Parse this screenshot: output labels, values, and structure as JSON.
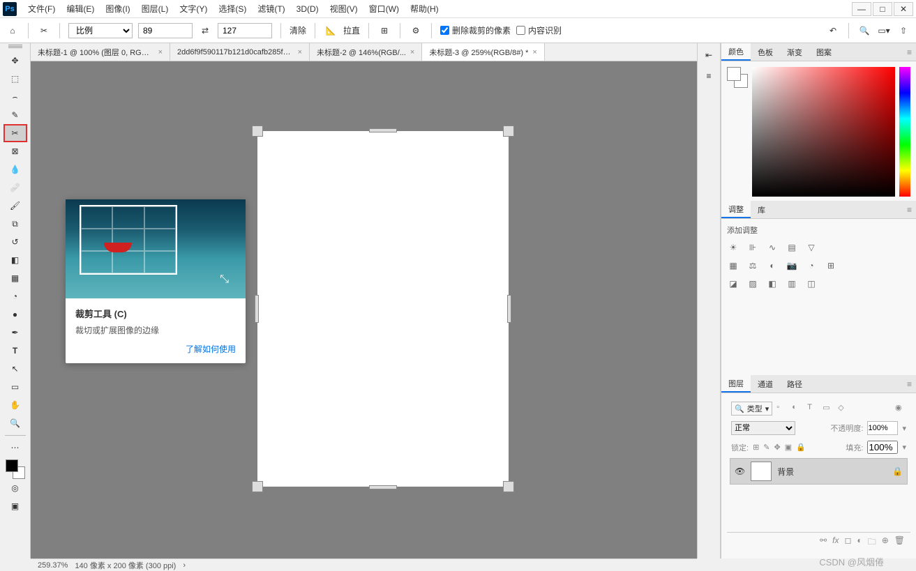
{
  "menu": {
    "items": [
      "文件(F)",
      "编辑(E)",
      "图像(I)",
      "图层(L)",
      "文字(Y)",
      "选择(S)",
      "滤镜(T)",
      "3D(D)",
      "视图(V)",
      "窗口(W)",
      "帮助(H)"
    ]
  },
  "options": {
    "ratio_label": "比例",
    "width": "89",
    "height": "127",
    "clear": "清除",
    "straighten": "拉直",
    "delete_cropped": "删除裁剪的像素",
    "content_aware": "内容识别"
  },
  "tabs": [
    {
      "label": "未标题-1 @ 100% (图层 0, RGB/8...",
      "active": false
    },
    {
      "label": "2dd6f9f590117b121d0cafb285f45916.png @ 66.7%(...",
      "active": false
    },
    {
      "label": "未标题-2 @ 146%(RGB/...",
      "active": false
    },
    {
      "label": "未标题-3 @ 259%(RGB/8#) *",
      "active": true
    }
  ],
  "tooltip": {
    "title": "裁剪工具 (C)",
    "desc": "裁切或扩展图像的边缘",
    "link": "了解如何使用"
  },
  "panels": {
    "color_tabs": [
      "颜色",
      "色板",
      "渐变",
      "图案"
    ],
    "adjust_tabs": [
      "调整",
      "库"
    ],
    "adjust_label": "添加调整",
    "layer_tabs": [
      "图层",
      "通道",
      "路径"
    ],
    "layer_type": "类型",
    "blend_mode": "正常",
    "opacity_label": "不透明度:",
    "opacity_value": "100%",
    "lock_label": "锁定:",
    "fill_label": "填充:",
    "fill_value": "100%",
    "layer_name": "背景"
  },
  "status": {
    "zoom": "259.37%",
    "dims": "140 像素 x 200 像素 (300 ppi)"
  },
  "watermark": "CSDN @风烟倦"
}
